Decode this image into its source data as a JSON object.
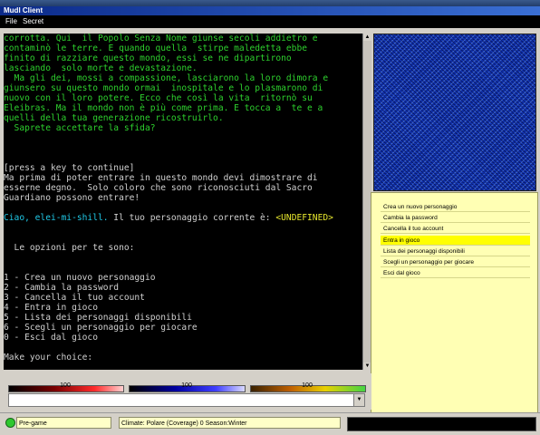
{
  "window": {
    "title": "Mudl Client"
  },
  "menu": {
    "file": "File",
    "secret": "Secret"
  },
  "console_lines": [
    {
      "text": "corrotta. Qui  il Popolo Senza Nome giunse secoli addietro e",
      "color": "#2ed12e"
    },
    {
      "text": "contaminò le terre. E quando quella  stirpe maledetta ebbe",
      "color": "#2ed12e"
    },
    {
      "text": "finito di razziare questo mondo, essi se ne dipartirono",
      "color": "#2ed12e"
    },
    {
      "text": "lasciando  solo morte e devastazione.",
      "color": "#2ed12e"
    },
    {
      "text": "  Ma gli dei, mossi a compassione, lasciarono la loro dimora e",
      "color": "#2ed12e"
    },
    {
      "text": "giunsero su questo mondo ormai  inospitale e lo plasmarono di",
      "color": "#2ed12e"
    },
    {
      "text": "nuovo con il loro potere. Ecco che così la vita  ritornò su",
      "color": "#2ed12e"
    },
    {
      "text": "Eleibras. Ma il mondo non è più come prima. E tocca a  te e a",
      "color": "#2ed12e"
    },
    {
      "text": "quelli della tua generazione ricostruirlo.",
      "color": "#2ed12e"
    },
    {
      "text": "  Saprete accettare la sfida?",
      "color": "#2ed12e"
    },
    {
      "text": "",
      "color": "#d0d0d0"
    },
    {
      "text": "",
      "color": "#d0d0d0"
    },
    {
      "text": "",
      "color": "#d0d0d0"
    },
    {
      "text": "[press a key to continue]",
      "color": "#d0d0d0"
    },
    {
      "text": "Ma prima di poter entrare in questo mondo devi dimostrare di",
      "color": "#d0d0d0"
    },
    {
      "text": "esserne degno.  Solo coloro che sono riconosciuti dal Sacro",
      "color": "#d0d0d0"
    },
    {
      "text": "Guardiano possono entrare!",
      "color": "#d0d0d0"
    },
    {
      "text": "",
      "color": "#d0d0d0"
    },
    {
      "text": "",
      "color": "#d0d0d0"
    },
    {
      "text": "",
      "color": "#d0d0d0"
    },
    {
      "text": "",
      "color": "#d0d0d0"
    },
    {
      "text": "  Le opzioni per te sono:",
      "color": "#d0d0d0"
    },
    {
      "text": "",
      "color": "#d0d0d0"
    },
    {
      "text": "",
      "color": "#d0d0d0"
    },
    {
      "text": "1 - Crea un nuovo personaggio",
      "color": "#d0d0d0"
    },
    {
      "text": "2 - Cambia la password",
      "color": "#d0d0d0"
    },
    {
      "text": "3 - Cancella il tuo account",
      "color": "#d0d0d0"
    },
    {
      "text": "4 - Entra in gioco",
      "color": "#d0d0d0"
    },
    {
      "text": "5 - Lista dei personaggi disponibili",
      "color": "#d0d0d0"
    },
    {
      "text": "6 - Scegli un personaggio per giocare",
      "color": "#d0d0d0"
    },
    {
      "text": "0 - Esci dal gioco",
      "color": "#d0d0d0"
    },
    {
      "text": "",
      "color": "#d0d0d0"
    },
    {
      "text": "Make your choice:",
      "color": "#d0d0d0"
    }
  ],
  "greeting": {
    "name": "Ciao, elei-mi-shill.",
    "middle": " Il tuo personaggio corrente è: ",
    "character": "<UNDEFINED>",
    "name_color": "#20c8e6",
    "middle_color": "#d0d0d0",
    "character_color": "#e6e62e"
  },
  "options_menu": [
    {
      "label": "Crea un nuovo personaggio",
      "selected": false
    },
    {
      "label": "Cambia la password",
      "selected": false
    },
    {
      "label": "Cancella il tuo account",
      "selected": false
    },
    {
      "label": "Entra in gioco",
      "selected": true
    },
    {
      "label": "Lista dei personaggi disponibili",
      "selected": false
    },
    {
      "label": "Scegli un personaggio per giocare",
      "selected": false
    },
    {
      "label": "Esci dal gioco",
      "selected": false
    }
  ],
  "stat_bars": [
    {
      "label": "100",
      "value": 1.0
    },
    {
      "label": "100",
      "value": 1.0
    },
    {
      "label": "100",
      "value": 1.0
    }
  ],
  "status": {
    "connection": "Pre-game",
    "climate": "Climate: Polare (Coverage) 0 Season:Winter"
  },
  "colors": {
    "selected_item": "#ffff00",
    "panel_bg": "#ffffb4",
    "online": "#2ec82e"
  }
}
